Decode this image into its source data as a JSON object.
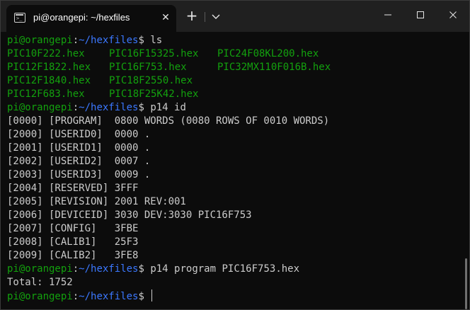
{
  "window": {
    "tab_title": "pi@orangepi: ~/hexfiles",
    "tab_icon_glyph": ">_",
    "new_tab_glyph": "+",
    "close_glyph": "✕",
    "colors": {
      "background": "#0c0c0c",
      "titlebar": "#202020",
      "text": "#cccccc",
      "prompt_user": "#13a10e",
      "prompt_path": "#3b78ff",
      "file_green": "#13a10e"
    }
  },
  "prompt": {
    "user_host": "pi@orangepi",
    "colon": ":",
    "path": "~/hexfiles",
    "dollar": "$"
  },
  "commands": {
    "ls": " ls",
    "p14_id": " p14 id",
    "p14_program": " p14 program PIC16F753.hex",
    "current": " "
  },
  "ls_rows": [
    [
      "PIC10F222.hex",
      "PIC16F15325.hex",
      "PIC24F08KL200.hex"
    ],
    [
      "PIC12F1822.hex",
      "PIC16F753.hex",
      "PIC32MX110F016B.hex"
    ],
    [
      "PIC12F1840.hex",
      "PIC18F2550.hex",
      ""
    ],
    [
      "PIC12F683.hex",
      "PIC18F25K42.hex",
      ""
    ]
  ],
  "id_output": [
    "[0000] [PROGRAM]  0800 WORDS (0080 ROWS OF 0010 WORDS)",
    "[2000] [USERID0]  0000 .",
    "[2001] [USERID1]  0000 .",
    "[2002] [USERID2]  0007 .",
    "[2003] [USERID3]  0009 .",
    "[2004] [RESERVED] 3FFF",
    "[2005] [REVISION] 2001 REV:001",
    "[2006] [DEVICEID] 3030 DEV:3030 PIC16F753",
    "[2007] [CONFIG]   3FBE",
    "[2008] [CALIB1]   25F3",
    "[2009] [CALIB2]   3FE8"
  ],
  "program_output": "Total: 1752"
}
